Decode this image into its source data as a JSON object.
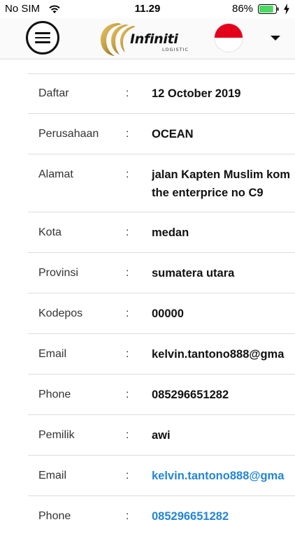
{
  "status_bar": {
    "carrier": "No SIM",
    "time": "11.29",
    "battery": "86%",
    "battery_level": 0.86,
    "battery_color": "#4cd964"
  },
  "header": {
    "menu_icon": "hamburger-icon",
    "logo": {
      "name": "Infiniti",
      "sub": "LOGISTIC",
      "colors": [
        "#c9a24a",
        "#8a6a25"
      ]
    },
    "language_flag": "indonesia-flag",
    "dropdown_icon": "caret-down-icon"
  },
  "details": {
    "rows": [
      {
        "label": "Daftar",
        "sep": ":",
        "value": "12 October 2019"
      },
      {
        "label": "Perusahaan",
        "sep": ":",
        "value": "OCEAN"
      },
      {
        "label": "Alamat",
        "sep": ":",
        "value": "jalan Kapten Muslim kom",
        "value2": "the enterprice no C9"
      },
      {
        "label": "Kota",
        "sep": ":",
        "value": "medan"
      },
      {
        "label": "Provinsi",
        "sep": ":",
        "value": "sumatera utara"
      },
      {
        "label": "Kodepos",
        "sep": ":",
        "value": "00000"
      },
      {
        "label": "Email",
        "sep": ":",
        "value": "kelvin.tantono888@gma"
      },
      {
        "label": "Phone",
        "sep": ":",
        "value": "085296651282"
      },
      {
        "label": "Pemilik",
        "sep": ":",
        "value": "awi"
      },
      {
        "label": "Email",
        "sep": ":",
        "value": "kelvin.tantono888@gma"
      },
      {
        "label": "Phone",
        "sep": ":",
        "value": "085296651282"
      }
    ],
    "link_color": "#2385d8"
  }
}
